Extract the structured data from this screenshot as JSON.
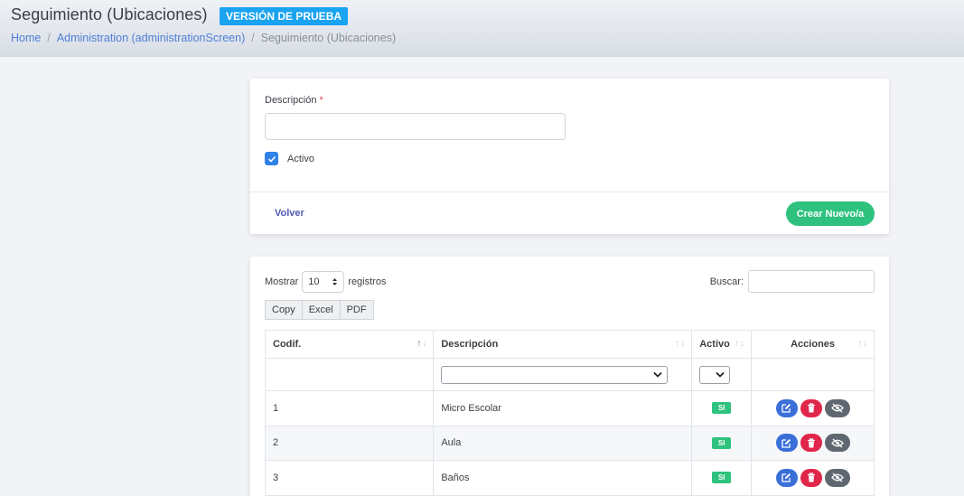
{
  "header": {
    "title": "Seguimiento (Ubicaciones)",
    "badge": "VERSIÓN DE PRUEBA",
    "breadcrumb": [
      "Home",
      "Administration (administrationScreen)",
      "Seguimiento (Ubicaciones)"
    ]
  },
  "form": {
    "description_label": "Descripción",
    "required_mark": "*",
    "description_value": "",
    "active_label": "Activo",
    "active_checked": true,
    "back_label": "Volver",
    "create_label": "Crear Nuevo/a"
  },
  "table_controls": {
    "show_label": "Mostrar",
    "page_length": "10",
    "records_label": "registros",
    "search_label": "Buscar:",
    "search_value": "",
    "export_buttons": [
      "Copy",
      "Excel",
      "PDF"
    ]
  },
  "table": {
    "columns": [
      "Codif.",
      "Descripción",
      "Activo",
      "Acciones"
    ],
    "rows": [
      {
        "code": "1",
        "description": "Micro Escolar",
        "active": "SI"
      },
      {
        "code": "2",
        "description": "Aula",
        "active": "SI"
      },
      {
        "code": "3",
        "description": "Baños",
        "active": "SI"
      }
    ]
  },
  "colors": {
    "badge": "#1aa3f0",
    "create_button": "#2ec27e",
    "edit": "#3a6fd8",
    "delete": "#e0264b",
    "hide": "#606770"
  },
  "icons": [
    "check-icon",
    "chevron-down-icon",
    "sort-icon",
    "edit-icon",
    "trash-icon",
    "eye-slash-icon"
  ]
}
